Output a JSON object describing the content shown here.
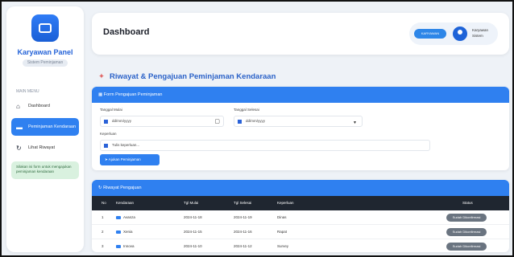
{
  "sidebar": {
    "brand": "Karyawan Panel",
    "brand_sub": "Sistem Peminjaman",
    "menu_caption": "MAIN MENU",
    "items": [
      {
        "label": "Dashboard",
        "icon": "home-icon"
      },
      {
        "label": "Peminjaman Kendaraan",
        "icon": "car-icon"
      },
      {
        "label": "Lihat Riwayat",
        "icon": "history-icon"
      }
    ],
    "note": "Silakan isi form untuk mengajukan peminjaman kendaraan"
  },
  "header": {
    "title": "Dashboard",
    "pill": "KARYAWAN",
    "user_name": "Karyawan Sistem"
  },
  "section": {
    "title": "Riwayat & Pengajuan Peminjaman Kendaraan"
  },
  "form": {
    "title": "Form Pengajuan Peminjaman",
    "start_label": "Tanggal Mulai",
    "start_value": "dd/mm/yyyy",
    "end_label": "Tanggal Selesai",
    "end_value": "dd/mm/yyyy",
    "purpose_label": "Keperluan",
    "purpose_placeholder": "Tulis keperluan...",
    "submit_label": "Ajukan Peminjaman"
  },
  "history": {
    "title": "Riwayat Pengajuan",
    "columns": [
      "No",
      "Kendaraan",
      "Tgl Mulai",
      "Tgl Selesai",
      "Keperluan",
      "Status"
    ],
    "rows": [
      {
        "no": "1",
        "vehicle": "Avanza",
        "start": "2024-11-18",
        "end": "2024-11-19",
        "purpose": "Dinas",
        "status": "Sudah Dikonfirmasi"
      },
      {
        "no": "2",
        "vehicle": "Xenia",
        "start": "2024-11-15",
        "end": "2024-11-16",
        "purpose": "Rapat",
        "status": "Sudah Dikonfirmasi"
      },
      {
        "no": "3",
        "vehicle": "Innova",
        "start": "2024-11-10",
        "end": "2024-11-12",
        "purpose": "Survey",
        "status": "Sudah Dikonfirmasi"
      }
    ]
  }
}
